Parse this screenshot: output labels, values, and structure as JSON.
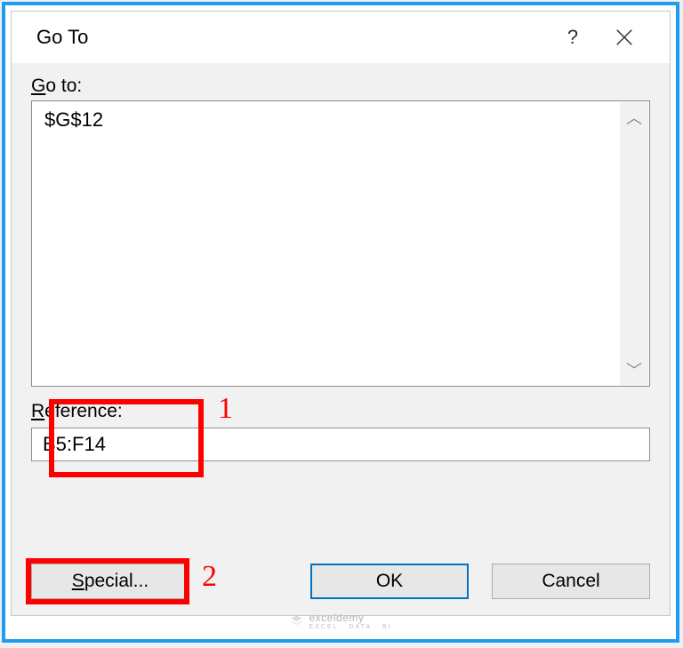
{
  "window": {
    "title": "Go To"
  },
  "goto": {
    "label_prefix": "G",
    "label_rest": "o to:",
    "items": [
      "$G$12"
    ]
  },
  "reference": {
    "label_prefix": "R",
    "label_rest": "eference:",
    "value": "B5:F14"
  },
  "buttons": {
    "special_prefix": "S",
    "special_rest": "pecial...",
    "ok": "OK",
    "cancel": "Cancel"
  },
  "annotations": {
    "num1": "1",
    "num2": "2"
  },
  "watermark": {
    "brand": "exceldemy",
    "sub": "EXCEL · DATA · BI"
  }
}
